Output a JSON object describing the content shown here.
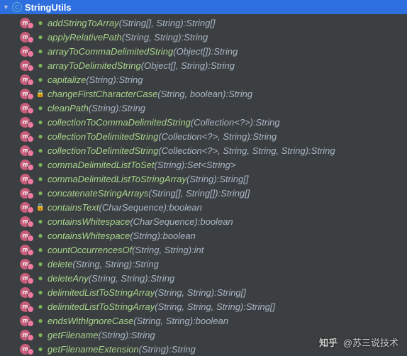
{
  "tab": {
    "label": "StringUtils",
    "icon_letter": "C"
  },
  "methods": [
    {
      "name": "addStringToArray",
      "params": "(String[], String)",
      "ret": "String[]",
      "vis": "public"
    },
    {
      "name": "applyRelativePath",
      "params": "(String, String)",
      "ret": "String",
      "vis": "public"
    },
    {
      "name": "arrayToCommaDelimitedString",
      "params": "(Object[])",
      "ret": "String",
      "vis": "public"
    },
    {
      "name": "arrayToDelimitedString",
      "params": "(Object[], String)",
      "ret": "String",
      "vis": "public"
    },
    {
      "name": "capitalize",
      "params": "(String)",
      "ret": "String",
      "vis": "public"
    },
    {
      "name": "changeFirstCharacterCase",
      "params": "(String, boolean)",
      "ret": "String",
      "vis": "private"
    },
    {
      "name": "cleanPath",
      "params": "(String)",
      "ret": "String",
      "vis": "public"
    },
    {
      "name": "collectionToCommaDelimitedString",
      "params": "(Collection<?>)",
      "ret": "String",
      "vis": "public"
    },
    {
      "name": "collectionToDelimitedString",
      "params": "(Collection<?>, String)",
      "ret": "String",
      "vis": "public"
    },
    {
      "name": "collectionToDelimitedString",
      "params": "(Collection<?>, String, String, String)",
      "ret": "String",
      "vis": "public"
    },
    {
      "name": "commaDelimitedListToSet",
      "params": "(String)",
      "ret": "Set<String>",
      "vis": "public"
    },
    {
      "name": "commaDelimitedListToStringArray",
      "params": "(String)",
      "ret": "String[]",
      "vis": "public"
    },
    {
      "name": "concatenateStringArrays",
      "params": "(String[], String[])",
      "ret": "String[]",
      "vis": "public"
    },
    {
      "name": "containsText",
      "params": "(CharSequence)",
      "ret": "boolean",
      "vis": "private"
    },
    {
      "name": "containsWhitespace",
      "params": "(CharSequence)",
      "ret": "boolean",
      "vis": "public"
    },
    {
      "name": "containsWhitespace",
      "params": "(String)",
      "ret": "boolean",
      "vis": "public"
    },
    {
      "name": "countOccurrencesOf",
      "params": "(String, String)",
      "ret": "int",
      "vis": "public"
    },
    {
      "name": "delete",
      "params": "(String, String)",
      "ret": "String",
      "vis": "public"
    },
    {
      "name": "deleteAny",
      "params": "(String, String)",
      "ret": "String",
      "vis": "public"
    },
    {
      "name": "delimitedListToStringArray",
      "params": "(String, String)",
      "ret": "String[]",
      "vis": "public"
    },
    {
      "name": "delimitedListToStringArray",
      "params": "(String, String, String)",
      "ret": "String[]",
      "vis": "public"
    },
    {
      "name": "endsWithIgnoreCase",
      "params": "(String, String)",
      "ret": "boolean",
      "vis": "public"
    },
    {
      "name": "getFilename",
      "params": "(String)",
      "ret": "String",
      "vis": "public"
    },
    {
      "name": "getFilenameExtension",
      "params": "(String)",
      "ret": "String",
      "vis": "public"
    }
  ],
  "watermark": {
    "logo": "知乎",
    "text": "@苏三说技术"
  }
}
